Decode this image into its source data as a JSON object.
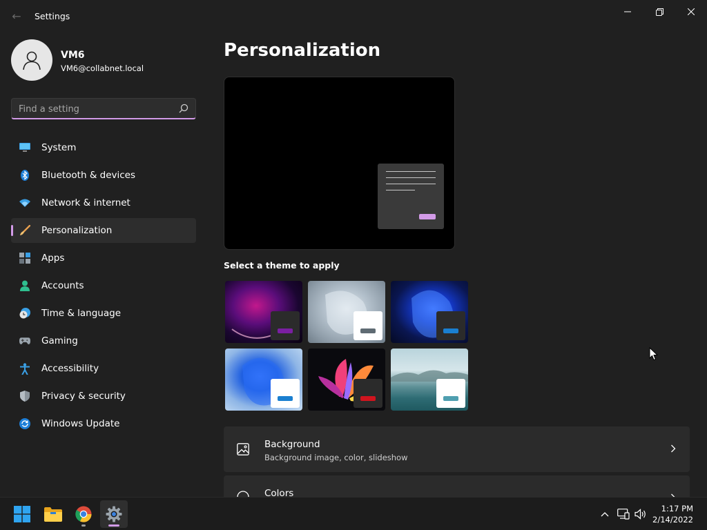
{
  "window": {
    "title": "Settings",
    "back_glyph": "←",
    "controls": [
      "minimize-icon",
      "restore-icon",
      "close-icon"
    ]
  },
  "account": {
    "name": "VM6",
    "email": "VM6@collabnet.local",
    "avatar_icon": "person-icon"
  },
  "search": {
    "placeholder": "Find a setting",
    "value": "",
    "icon": "search-icon"
  },
  "sidebar": {
    "items": [
      {
        "label": "System",
        "icon": "monitor-icon",
        "active": false
      },
      {
        "label": "Bluetooth & devices",
        "icon": "bluetooth-icon",
        "active": false
      },
      {
        "label": "Network & internet",
        "icon": "wifi-icon",
        "active": false
      },
      {
        "label": "Personalization",
        "icon": "brush-icon",
        "active": true
      },
      {
        "label": "Apps",
        "icon": "apps-icon",
        "active": false
      },
      {
        "label": "Accounts",
        "icon": "account-icon",
        "active": false
      },
      {
        "label": "Time & language",
        "icon": "clock-globe-icon",
        "active": false
      },
      {
        "label": "Gaming",
        "icon": "gamepad-icon",
        "active": false
      },
      {
        "label": "Accessibility",
        "icon": "accessibility-icon",
        "active": false
      },
      {
        "label": "Privacy & security",
        "icon": "shield-icon",
        "active": false
      },
      {
        "label": "Windows Update",
        "icon": "update-icon",
        "active": false
      }
    ]
  },
  "main": {
    "title": "Personalization",
    "theme_section_label": "Select a theme to apply",
    "themes": [
      {
        "accent": "#7a1fa2"
      },
      {
        "accent": "#5f6b73"
      },
      {
        "accent": "#1a7fd0"
      },
      {
        "accent": "#1a7fd0"
      },
      {
        "accent": "#d0141e"
      },
      {
        "accent": "#4f9fb0"
      }
    ],
    "cards": [
      {
        "title": "Background",
        "subtitle": "Background image, color, slideshow",
        "icon": "image-icon"
      },
      {
        "title": "Colors",
        "subtitle": "",
        "icon": "palette-icon"
      }
    ]
  },
  "taskbar": {
    "apps": [
      "windows-start-icon",
      "file-explorer-icon",
      "chrome-icon",
      "settings-icon"
    ],
    "tray": [
      "chevron-up-icon",
      "network-icon",
      "volume-icon"
    ],
    "time": "1:17 PM",
    "date": "2/14/2022"
  },
  "colors": {
    "accent": "#d39be8",
    "background": "#202020",
    "card": "#2b2b2b"
  }
}
